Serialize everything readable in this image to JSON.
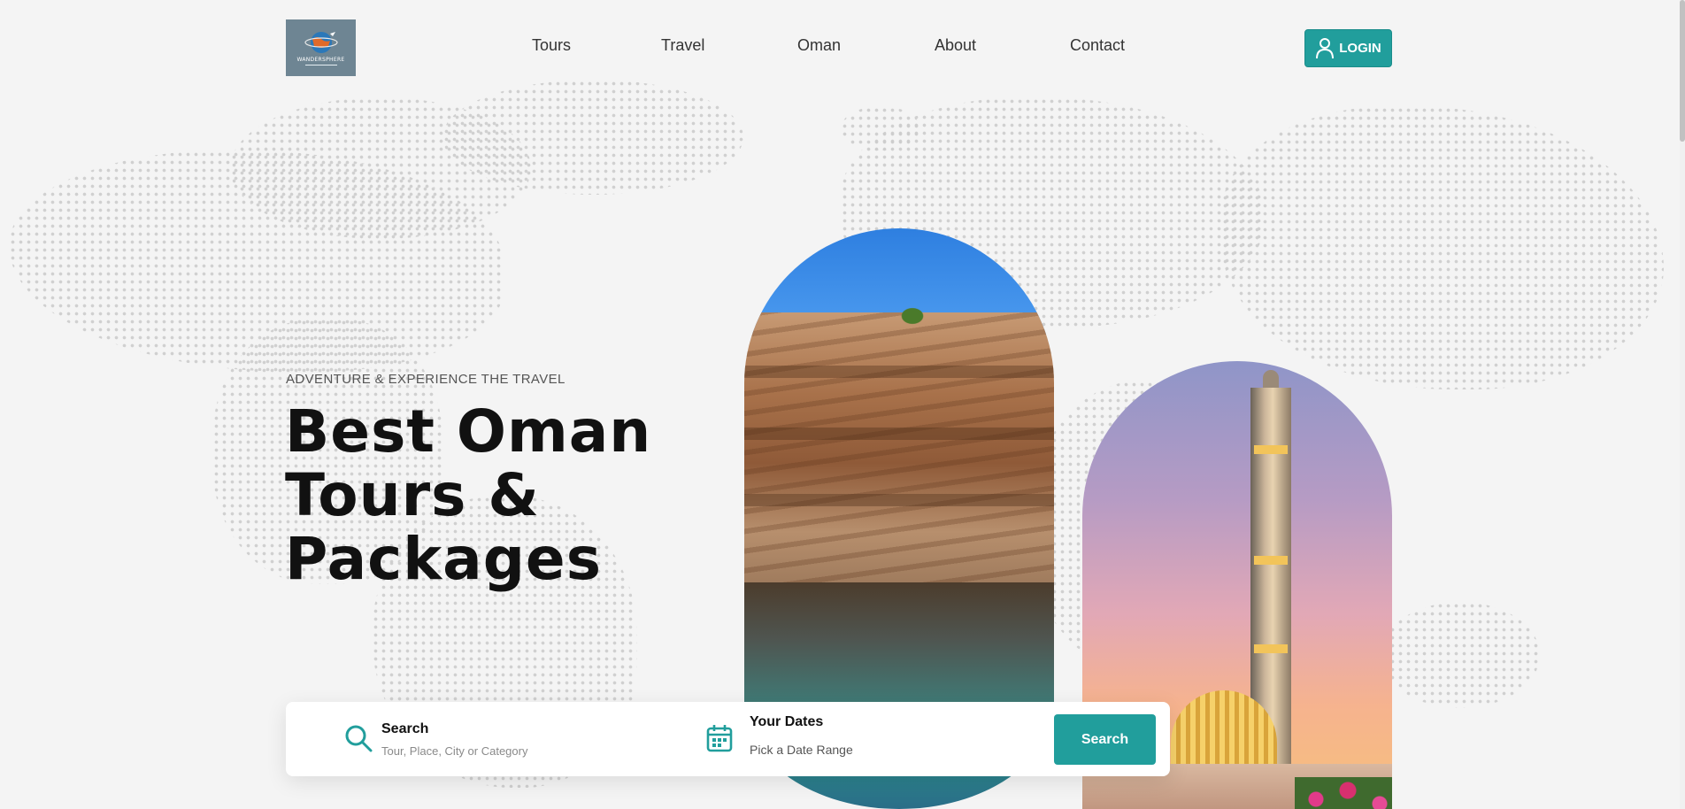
{
  "brand": {
    "logo_text": "WANDERSPHERE",
    "accent": "#219e9c"
  },
  "nav": {
    "items": [
      {
        "label": "Tours"
      },
      {
        "label": "Travel"
      },
      {
        "label": "Oman"
      },
      {
        "label": "About"
      },
      {
        "label": "Contact"
      }
    ]
  },
  "login": {
    "label": "LOGIN",
    "icon": "user-icon"
  },
  "hero": {
    "eyebrow": "ADVENTURE & EXPERIENCE THE TRAVEL",
    "title_lines": [
      "Best Oman",
      "Tours &",
      "Packages"
    ]
  },
  "images": {
    "left_arch": "wadi-canyon-pool-photo",
    "right_arch": "mosque-minaret-sunset-photo"
  },
  "search": {
    "label": "Search",
    "placeholder": "Tour, Place, City or Category",
    "dates_label": "Your Dates",
    "dates_placeholder": "Pick a Date Range",
    "button_label": "Search",
    "search_icon": "search-icon",
    "calendar_icon": "calendar-icon"
  }
}
